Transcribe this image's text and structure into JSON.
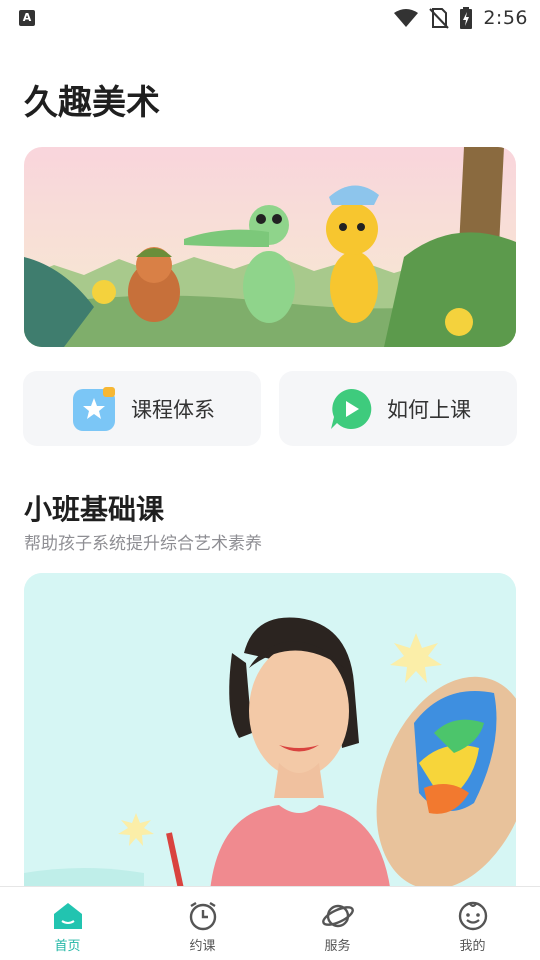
{
  "status": {
    "notification_badge": "A",
    "time": "2:56"
  },
  "app": {
    "title": "久趣美术"
  },
  "quick_entries": [
    {
      "label": "课程体系",
      "icon": "star-icon"
    },
    {
      "label": "如何上课",
      "icon": "play-icon"
    }
  ],
  "section": {
    "title": "小班基础课",
    "subtitle": "帮助孩子系统提升综合艺术素养"
  },
  "tabs": [
    {
      "label": "首页",
      "icon": "home-icon",
      "active": true
    },
    {
      "label": "约课",
      "icon": "alarm-clock-icon",
      "active": false
    },
    {
      "label": "服务",
      "icon": "planet-icon",
      "active": false
    },
    {
      "label": "我的",
      "icon": "smiley-face-icon",
      "active": false
    }
  ],
  "colors": {
    "accent": "#22b7a6",
    "entry_bg": "#f5f6f8",
    "card_bg": "#d9f5f3"
  }
}
